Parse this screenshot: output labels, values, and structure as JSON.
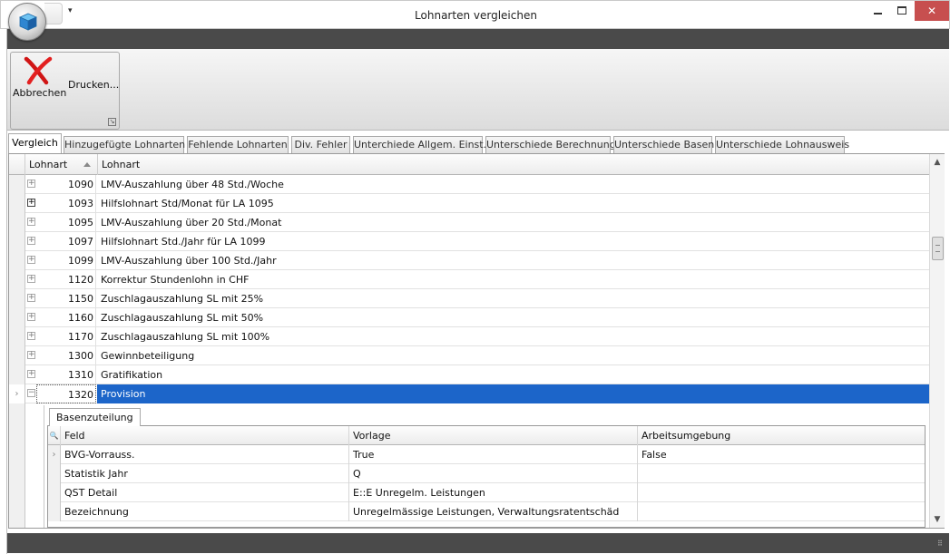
{
  "window": {
    "title": "Lohnarten vergleichen",
    "minimize": "minimize",
    "maximize": "maximize",
    "close": "✕"
  },
  "ribbon": {
    "cancel_label": "Abbrechen",
    "print_label": "Drucken..."
  },
  "tabs": [
    "Vergleich",
    "Hinzugefügte Lohnarten",
    "Fehlende Lohnarten",
    "Div. Fehler",
    "Unterchiede Allgem. Einst.",
    "Unterschiede Berechnung",
    "Unterschiede Basen",
    "Unterschiede Lohnausweis"
  ],
  "grid": {
    "columns": {
      "number": "Lohnart",
      "name": "Lohnart"
    },
    "rows": [
      {
        "number": "1090",
        "name": "LMV-Auszahlung über 48 Std./Woche"
      },
      {
        "number": "1093",
        "name": "Hilfslohnart Std/Monat für LA 1095"
      },
      {
        "number": "1095",
        "name": "LMV-Auszahlung über 20 Std./Monat"
      },
      {
        "number": "1097",
        "name": "Hilfslohnart Std./Jahr für LA 1099"
      },
      {
        "number": "1099",
        "name": "LMV-Auszahlung über 100 Std./Jahr"
      },
      {
        "number": "1120",
        "name": "Korrektur Stundenlohn in CHF"
      },
      {
        "number": "1150",
        "name": "Zuschlagauszahlung SL mit 25%"
      },
      {
        "number": "1160",
        "name": "Zuschlagauszahlung SL mit 50%"
      },
      {
        "number": "1170",
        "name": "Zuschlagauszahlung SL mit 100%"
      },
      {
        "number": "1300",
        "name": "Gewinnbeteiligung"
      },
      {
        "number": "1310",
        "name": "Gratifikation"
      },
      {
        "number": "1320",
        "name": "Provision"
      }
    ]
  },
  "detail": {
    "tab": "Basenzuteilung",
    "columns": {
      "field": "Feld",
      "template": "Vorlage",
      "environment": "Arbeitsumgebung"
    },
    "rows": [
      {
        "field": "BVG-Vorrauss.",
        "template": "True",
        "environment": "False"
      },
      {
        "field": "Statistik Jahr",
        "template": "Q",
        "environment": ""
      },
      {
        "field": "QST Detail",
        "template": "E::E Unregelm. Leistungen",
        "environment": ""
      },
      {
        "field": "Bezeichnung",
        "template": "Unregelmässige Leistungen, Verwaltungsratentschäd",
        "environment": ""
      }
    ]
  }
}
